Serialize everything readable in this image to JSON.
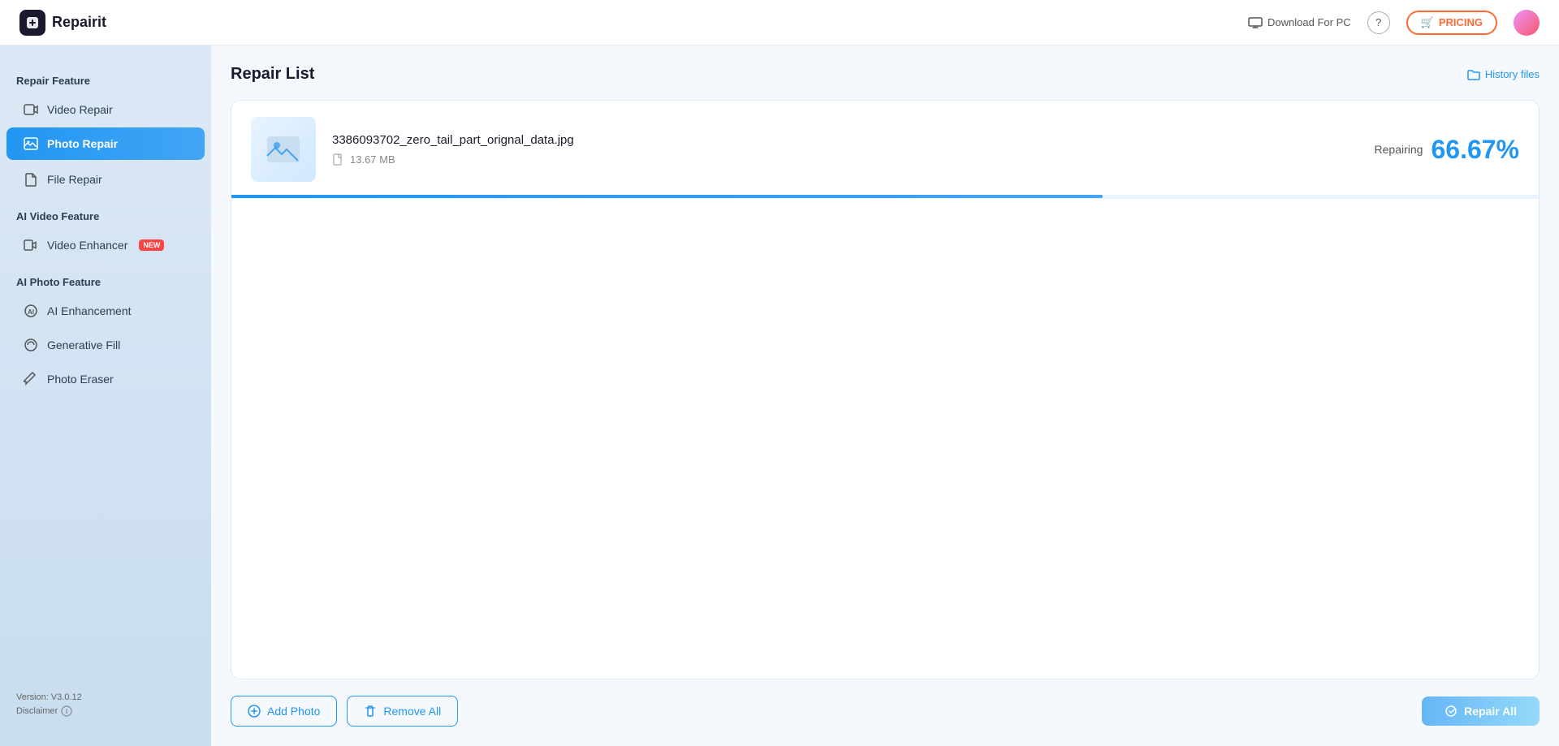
{
  "header": {
    "logo_text": "Repairit",
    "download_label": "Download For PC",
    "pricing_label": "PRICING",
    "pricing_icon": "🛒"
  },
  "sidebar": {
    "sections": [
      {
        "label": "Repair Feature",
        "items": [
          {
            "id": "video-repair",
            "label": "Video Repair",
            "active": false
          },
          {
            "id": "photo-repair",
            "label": "Photo Repair",
            "active": true
          }
        ]
      },
      {
        "label": "",
        "items": [
          {
            "id": "file-repair",
            "label": "File Repair",
            "active": false
          }
        ]
      },
      {
        "label": "AI Video Feature",
        "items": [
          {
            "id": "video-enhancer",
            "label": "Video Enhancer",
            "active": false,
            "badge": "NEW"
          }
        ]
      },
      {
        "label": "AI Photo Feature",
        "items": [
          {
            "id": "ai-enhancement",
            "label": "AI Enhancement",
            "active": false
          },
          {
            "id": "generative-fill",
            "label": "Generative Fill",
            "active": false
          },
          {
            "id": "photo-eraser",
            "label": "Photo Eraser",
            "active": false
          }
        ]
      }
    ],
    "version": "Version: V3.0.12",
    "disclaimer": "Disclaimer"
  },
  "content": {
    "title": "Repair List",
    "history_label": "History files",
    "repair_item": {
      "filename": "3386093702_zero_tail_part_orignal_data.jpg",
      "filesize": "13.67 MB",
      "status_label": "Repairing",
      "percent": "66.67%",
      "progress": 66.67
    },
    "buttons": {
      "add_photo": "Add Photo",
      "remove_all": "Remove All",
      "repair_all": "Repair All"
    }
  },
  "colors": {
    "accent": "#2196f3",
    "active_gradient_start": "#2196f3",
    "active_gradient_end": "#42a5f5",
    "pricing_color": "#ff6b35"
  }
}
